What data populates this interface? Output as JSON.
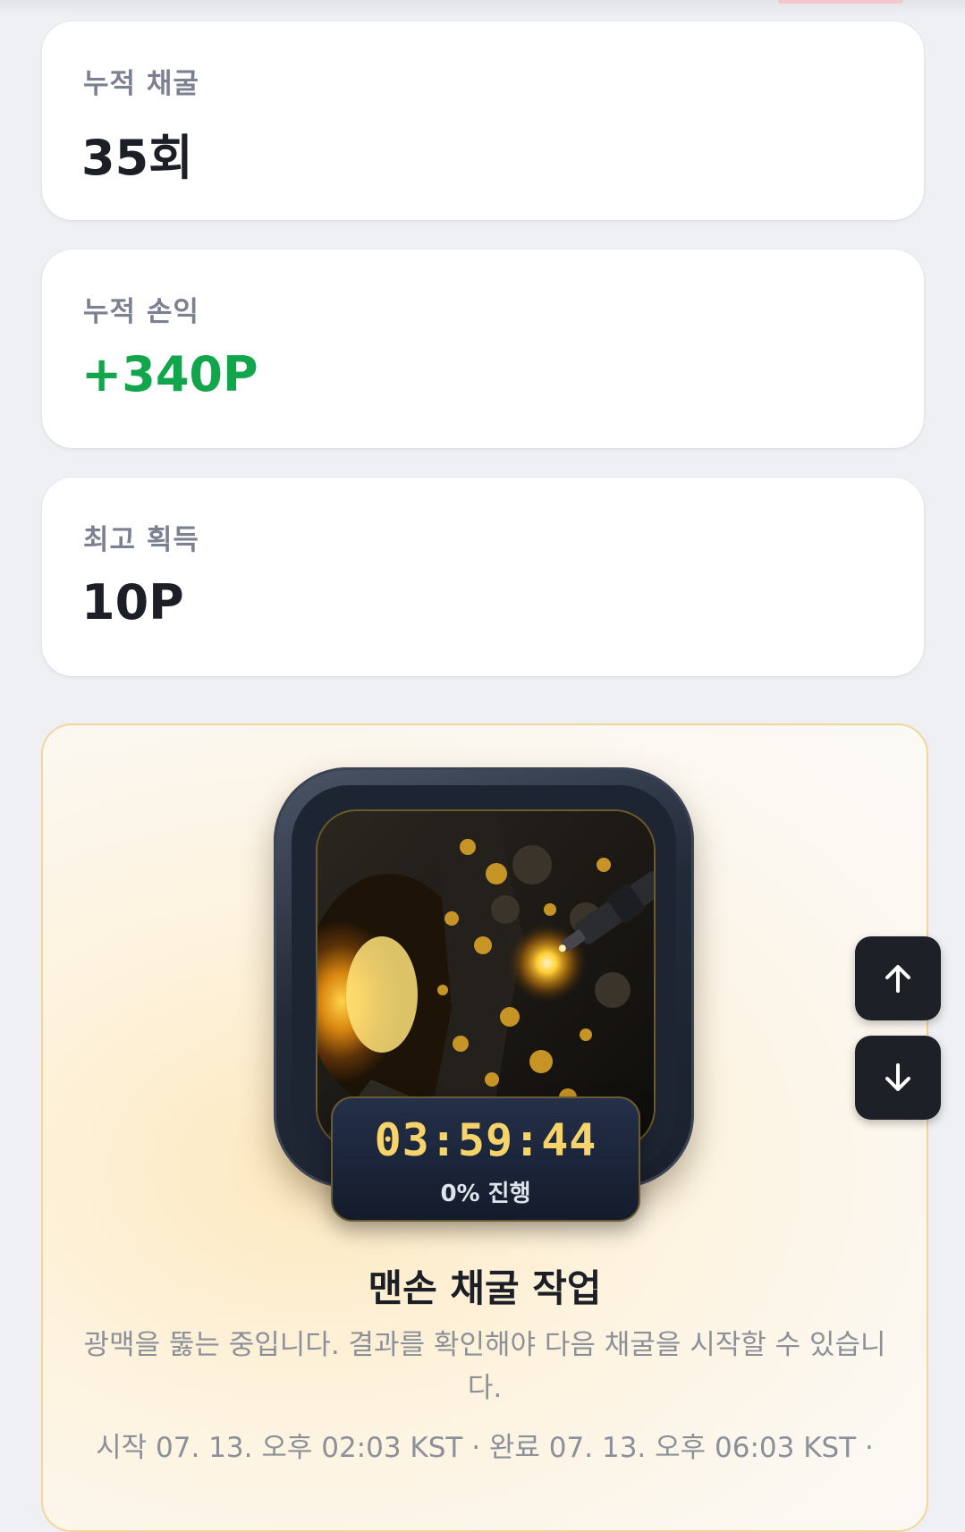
{
  "stats": {
    "mining_count": {
      "label": "누적 채굴",
      "value": "35회"
    },
    "profit": {
      "label": "누적 손익",
      "value": "+340P"
    },
    "best": {
      "label": "최고 획득",
      "value": "10P"
    }
  },
  "mining": {
    "timer": "03:59:44",
    "progress_text": "0% 진행",
    "progress_percent": 0,
    "title": "맨손 채굴 작업",
    "description": "광맥을 뚫는 중입니다. 결과를 확인해야 다음 채굴을 시작할 수 있습니다.",
    "time_info": "시작 07. 13. 오후 02:03 KST · 완료 07. 13. 오후 06:03 KST ·"
  },
  "scroll_controls": {
    "up_icon": "arrow-up-icon",
    "down_icon": "arrow-down-icon"
  },
  "colors": {
    "positive": "#13a54b",
    "timer": "#f7d36b",
    "card_border": "#f2d59c"
  }
}
